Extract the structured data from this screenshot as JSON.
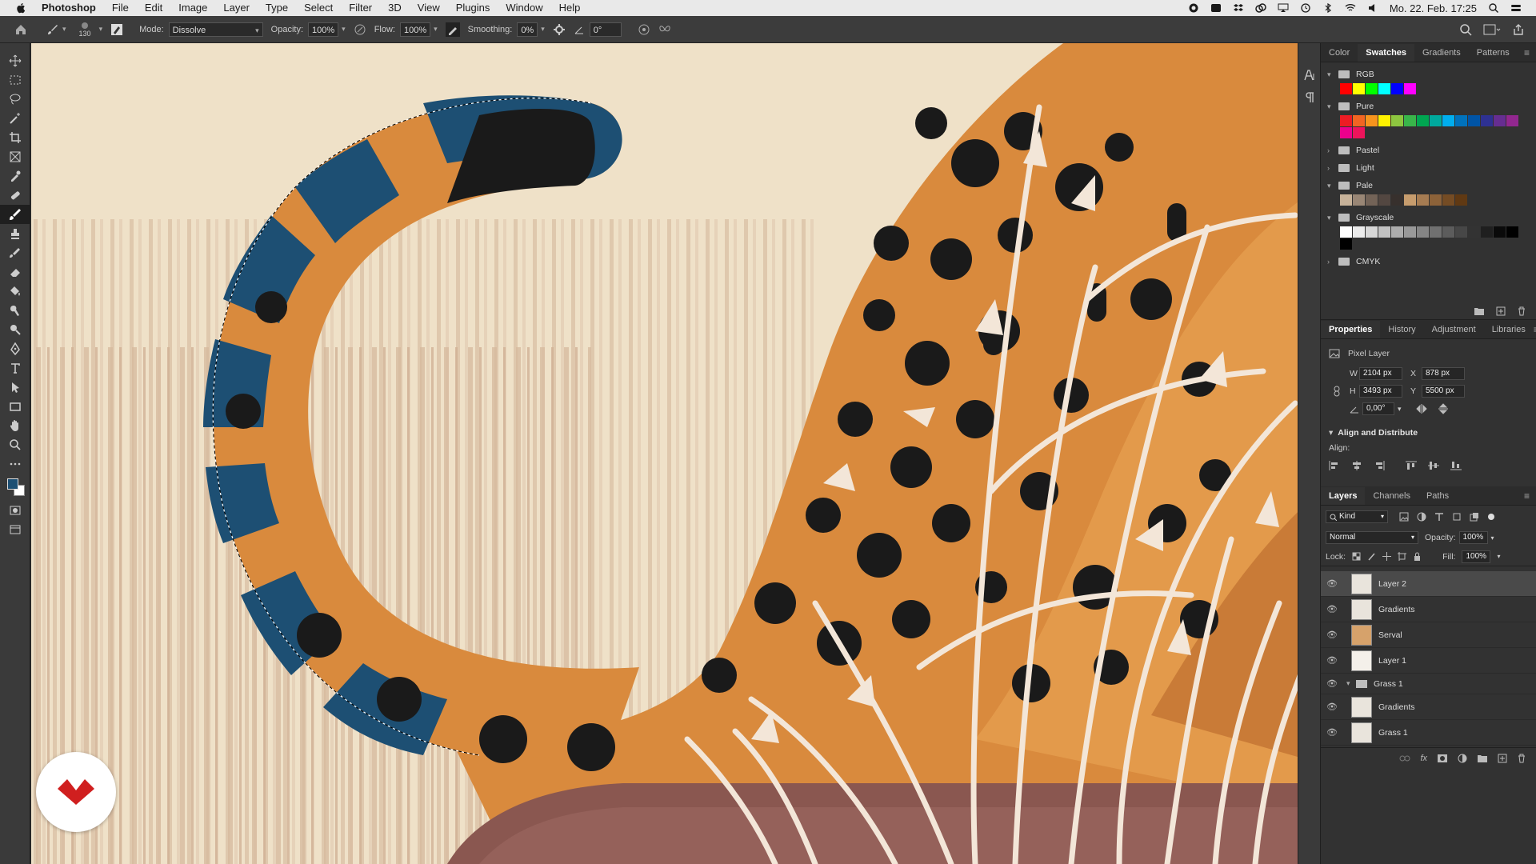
{
  "menubar": {
    "app_name": "Photoshop",
    "items": [
      "File",
      "Edit",
      "Image",
      "Layer",
      "Type",
      "Select",
      "Filter",
      "3D",
      "View",
      "Plugins",
      "Window",
      "Help"
    ],
    "clock": "Mo. 22. Feb. 17:25"
  },
  "options": {
    "brush_size": "130",
    "mode_label": "Mode:",
    "mode_value": "Dissolve",
    "opacity_label": "Opacity:",
    "opacity_value": "100%",
    "flow_label": "Flow:",
    "flow_value": "100%",
    "smoothing_label": "Smoothing:",
    "smoothing_value": "0%",
    "angle_value": "0°"
  },
  "swatches": {
    "tabs": [
      "Color",
      "Swatches",
      "Gradients",
      "Patterns"
    ],
    "active_tab": "Swatches",
    "groups": [
      {
        "name": "RGB",
        "open": true,
        "colors": [
          "#ff0000",
          "#ffff00",
          "#00ff00",
          "#00ffff",
          "#0000ff",
          "#ff00ff"
        ]
      },
      {
        "name": "Pure",
        "open": true,
        "colors": [
          "#ed1c24",
          "#f26522",
          "#f7941d",
          "#fff200",
          "#8dc63f",
          "#39b54a",
          "#00a651",
          "#00a99d",
          "#00aeef",
          "#0072bc",
          "#0054a6",
          "#2e3192",
          "#662d91",
          "#92278f",
          "#ec008c",
          "#ed145b"
        ]
      },
      {
        "name": "Pastel",
        "open": false,
        "colors": []
      },
      {
        "name": "Light",
        "open": false,
        "colors": []
      },
      {
        "name": "Pale",
        "open": true,
        "colors": [
          "#c7b299",
          "#998675",
          "#736357",
          "#534741",
          "#37302d",
          "#c69c6d",
          "#a67c52",
          "#8c6239",
          "#754c24",
          "#603913"
        ]
      },
      {
        "name": "Grayscale",
        "open": true,
        "colors": [
          "#ffffff",
          "#ebebeb",
          "#d7d7d7",
          "#c2c2c2",
          "#adadad",
          "#999999",
          "#858585",
          "#707070",
          "#5c5c5c",
          "#474747",
          "#333333",
          "#1f1f1f",
          "#0a0a0a",
          "#000000",
          "#000000"
        ]
      },
      {
        "name": "CMYK",
        "open": false,
        "colors": []
      }
    ]
  },
  "properties": {
    "tabs": [
      "Properties",
      "History",
      "Adjustment",
      "Libraries"
    ],
    "active_tab": "Properties",
    "layer_type": "Pixel Layer",
    "w_label": "W",
    "w": "2104 px",
    "h_label": "H",
    "h": "3493 px",
    "x_label": "X",
    "x": "878 px",
    "y_label": "Y",
    "y": "5500 px",
    "angle": "0,00°",
    "align_title": "Align and Distribute",
    "align_label": "Align:"
  },
  "layers_panel": {
    "tabs": [
      "Layers",
      "Channels",
      "Paths"
    ],
    "active_tab": "Layers",
    "filter_kind": "Kind",
    "blend_mode": "Normal",
    "opacity_label": "Opacity:",
    "opacity": "100%",
    "lock_label": "Lock:",
    "fill_label": "Fill:",
    "fill": "100%",
    "layers": [
      {
        "name": "Layer 2",
        "selected": true,
        "group": false
      },
      {
        "name": "Gradients",
        "selected": false,
        "group": false
      },
      {
        "name": "Serval",
        "selected": false,
        "group": false
      },
      {
        "name": "Layer 1",
        "selected": false,
        "group": false
      },
      {
        "name": "Grass 1",
        "selected": false,
        "group": true
      },
      {
        "name": "Gradients",
        "selected": false,
        "group": false
      },
      {
        "name": "Grass 1",
        "selected": false,
        "group": false
      }
    ]
  },
  "colors": {
    "canvas_bg": "#efe1c8",
    "fur": "#d98a3d",
    "tail_blue": "#1d4f73",
    "spot": "#1a1a1a",
    "ground": "#8a5750",
    "badge_red": "#d01f1f"
  }
}
